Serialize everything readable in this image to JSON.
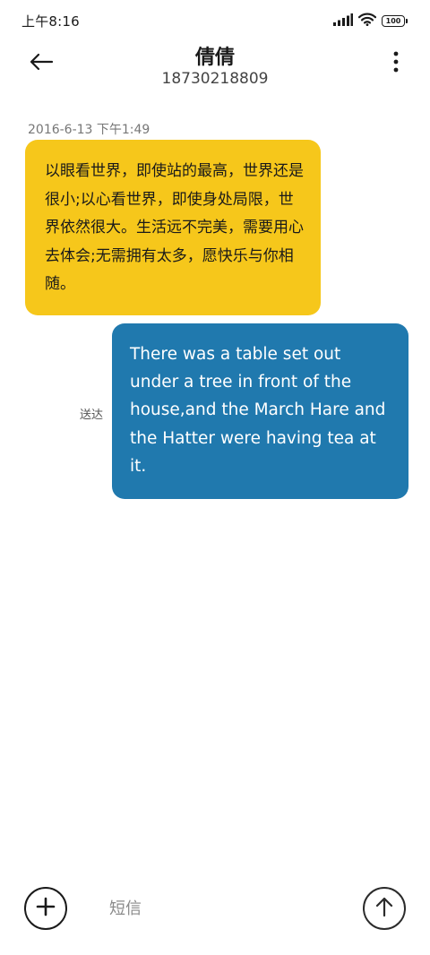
{
  "status_bar": {
    "time": "上午8:16",
    "battery": "100",
    "icons": [
      "signal-icon",
      "wifi-icon",
      "battery-icon"
    ]
  },
  "header": {
    "contact_name": "倩倩",
    "contact_number": "18730218809",
    "back_icon": "arrow-left-icon",
    "menu_icon": "more-vertical-icon"
  },
  "conversation": {
    "timestamp": "2016-6-13 下午1:49",
    "incoming": {
      "text": "以眼看世界，即使站的最高，世界还是很小;以心看世界，即使身处局限，世界依然很大。生活远不完美，需要用心去体会;无需拥有太多，愿快乐与你相随。",
      "color": "#f6c71b"
    },
    "outgoing": {
      "text": "There was a table set out under a tree in front of the house,and the March Hare and the Hatter were having tea at it.",
      "status": "送达",
      "color": "#2079ae"
    }
  },
  "composer": {
    "placeholder": "短信",
    "value": "",
    "add_icon": "plus-icon",
    "send_icon": "arrow-up-icon"
  }
}
